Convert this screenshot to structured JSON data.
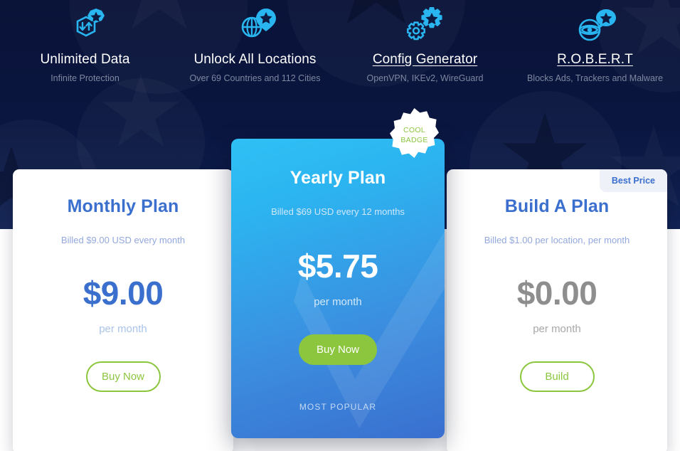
{
  "theme": {
    "navy": "#0a1640",
    "accent_blue": "#3a6fce",
    "cyan": "#2cb8f0",
    "green": "#8cc63e",
    "muted_blue": "#93a8dd",
    "grey_price": "#8e8e8e"
  },
  "features": [
    {
      "icon": "unlimited-data-icon",
      "title": "Unlimited Data",
      "subtitle": "Infinite Protection",
      "is_link": false
    },
    {
      "icon": "globe-pin-icon",
      "title": "Unlock All Locations",
      "subtitle": "Over 69 Countries and 112 Cities",
      "is_link": false
    },
    {
      "icon": "gears-icon",
      "title": "Config Generator",
      "subtitle": "OpenVPN, IKEv2, WireGuard",
      "is_link": true
    },
    {
      "icon": "eye-globe-icon",
      "title": "R.O.B.E.R.T",
      "subtitle": "Blocks Ads, Trackers and Malware",
      "is_link": true
    }
  ],
  "badges": {
    "cool_badge_line1": "COOL",
    "cool_badge_line2": "BADGE",
    "best_price": "Best Price"
  },
  "plans": {
    "monthly": {
      "title": "Monthly Plan",
      "billed": "Billed $9.00 USD every month",
      "price": "$9.00",
      "period": "per month",
      "button": "Buy Now"
    },
    "yearly": {
      "title": "Yearly Plan",
      "billed": "Billed $69 USD every 12 months",
      "price": "$5.75",
      "period": "per month",
      "button": "Buy Now",
      "footer": "MOST POPULAR"
    },
    "build": {
      "title": "Build A Plan",
      "billed": "Billed $1.00 per location, per month",
      "price": "$0.00",
      "period": "per month",
      "button": "Build"
    }
  }
}
